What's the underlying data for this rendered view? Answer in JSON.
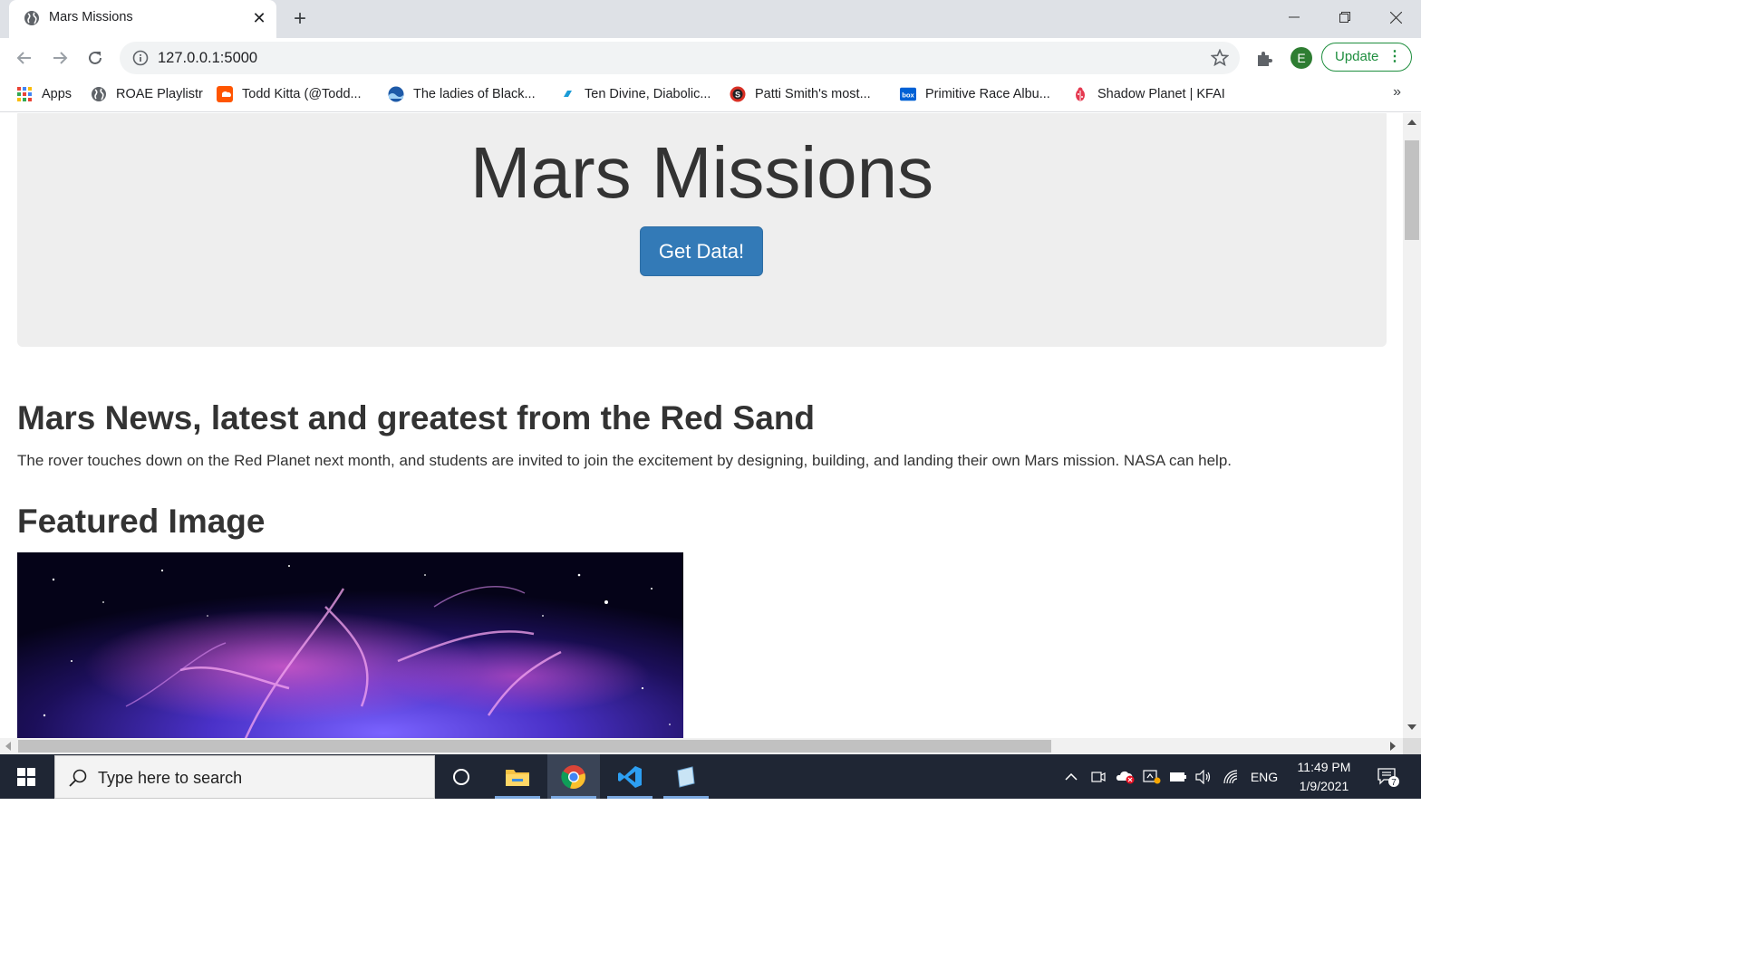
{
  "browser": {
    "tab_title": "Mars Missions",
    "url": "127.0.0.1:5000",
    "profile_initial": "E",
    "update_label": "Update"
  },
  "bookmarks": [
    {
      "label": "Apps",
      "icon": "apps-grid-icon"
    },
    {
      "label": "ROAE Playlistr",
      "icon": "globe-icon"
    },
    {
      "label": "Todd Kitta (@Todd...",
      "icon": "soundcloud-icon"
    },
    {
      "label": "The ladies of Black...",
      "icon": "wave-icon"
    },
    {
      "label": "Ten Divine, Diabolic...",
      "icon": "blue-flag-icon"
    },
    {
      "label": "Patti Smith's most...",
      "icon": "s-circle-icon"
    },
    {
      "label": "Primitive Race Albu...",
      "icon": "box-icon"
    },
    {
      "label": "Shadow Planet | KFAI",
      "icon": "bug-icon"
    }
  ],
  "page": {
    "jumbo_title": "Mars Missions",
    "get_data_label": "Get Data!",
    "news_title": "Mars News, latest and greatest from the Red Sand",
    "news_paragraph": "The rover touches down on the Red Planet next month, and students are invited to join the excitement by designing, building, and landing their own Mars mission. NASA can help.",
    "featured_title": "Featured Image"
  },
  "taskbar": {
    "search_placeholder": "Type here to search",
    "language": "ENG",
    "time": "11:49 PM",
    "date": "1/9/2021",
    "notification_count": "7"
  },
  "colors": {
    "button_primary": "#337ab7",
    "jumbotron_bg": "#eeeeee",
    "update_green": "#1e8e3e"
  }
}
